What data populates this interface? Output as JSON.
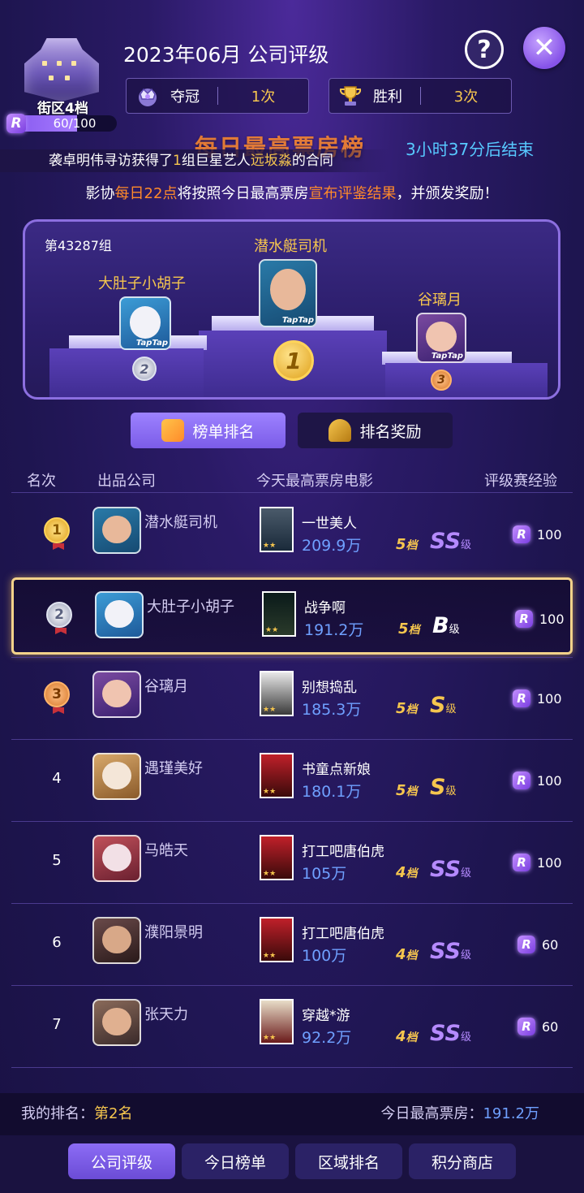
{
  "header": {
    "district_level": "街区4档",
    "district_progress_text": "60/100",
    "district_progress": 0.6,
    "title": "2023年06月 公司评级",
    "help_symbol": "?",
    "close_symbol": "✕",
    "stats": [
      {
        "label": "夺冠",
        "value": "1次",
        "icon": "crown-icon"
      },
      {
        "label": "胜利",
        "value": "3次",
        "icon": "trophy-icon"
      }
    ]
  },
  "banner": {
    "heading": "每日最高票房榜",
    "countdown": "3小时37分后结束",
    "news_prefix": "袭卓明伟寻访获得了",
    "news_highlight1": "1",
    "news_mid": "组巨星艺人",
    "news_highlight2": "远坂淼",
    "news_suffix": "的合同",
    "notice_a": "影协",
    "notice_b": "每日22点",
    "notice_c": "将按照今日最高票房",
    "notice_d": "宣布评鉴结果",
    "notice_e": "，并颁发奖励！"
  },
  "podium": {
    "group_id": "第43287组",
    "first": {
      "name": "潜水艇司机",
      "medal": "1"
    },
    "second": {
      "name": "大肚子小胡子",
      "medal": "2"
    },
    "third": {
      "name": "谷璃月",
      "medal": "3"
    },
    "avatar_tag": "TapTap"
  },
  "tabs": [
    {
      "label": "榜单排名",
      "active": true
    },
    {
      "label": "排名奖励",
      "active": false
    }
  ],
  "table": {
    "headers": [
      "名次",
      "出品公司",
      "今天最高票房电影",
      "评级赛经验"
    ],
    "rows": [
      {
        "rank": "1",
        "company": "潜水艇司机",
        "movie": "一世美人",
        "box": "209.9万",
        "tier": "5",
        "tier_unit": "档",
        "grade": "SS",
        "grade_unit": "级",
        "exp": "100"
      },
      {
        "rank": "2",
        "company": "大肚子小胡子",
        "movie": "战争啊",
        "box": "191.2万",
        "tier": "5",
        "tier_unit": "档",
        "grade": "B",
        "grade_unit": "级",
        "exp": "100"
      },
      {
        "rank": "3",
        "company": "谷璃月",
        "movie": "别想捣乱",
        "box": "185.3万",
        "tier": "5",
        "tier_unit": "档",
        "grade": "S",
        "grade_unit": "级",
        "exp": "100"
      },
      {
        "rank": "4",
        "company": "遇瑾美好",
        "movie": "书童点新娘",
        "box": "180.1万",
        "tier": "5",
        "tier_unit": "档",
        "grade": "S",
        "grade_unit": "级",
        "exp": "100"
      },
      {
        "rank": "5",
        "company": "马皓天",
        "movie": "打工吧唐伯虎",
        "box": "105万",
        "tier": "4",
        "tier_unit": "档",
        "grade": "SS",
        "grade_unit": "级",
        "exp": "100"
      },
      {
        "rank": "6",
        "company": "濮阳景明",
        "movie": "打工吧唐伯虎",
        "box": "100万",
        "tier": "4",
        "tier_unit": "档",
        "grade": "SS",
        "grade_unit": "级",
        "exp": "60"
      },
      {
        "rank": "7",
        "company": "张天力",
        "movie": "穿越*游",
        "box": "92.2万",
        "tier": "4",
        "tier_unit": "档",
        "grade": "SS",
        "grade_unit": "级",
        "exp": "60"
      }
    ],
    "exp_icon": "R"
  },
  "footer": {
    "my_rank_label": "我的排名：",
    "my_rank_value": "第2名",
    "today_box_label": "今日最高票房：",
    "today_box_value": "191.2万",
    "nav": [
      "公司评级",
      "今日榜单",
      "区域排名",
      "积分商店"
    ]
  },
  "colors": {
    "gold": "#f6c64e",
    "blue_value": "#6fa0ff",
    "accent_purple": "#8c6cf5",
    "highlight_orange": "#ff8a2a",
    "countdown_blue": "#57c9ff"
  }
}
